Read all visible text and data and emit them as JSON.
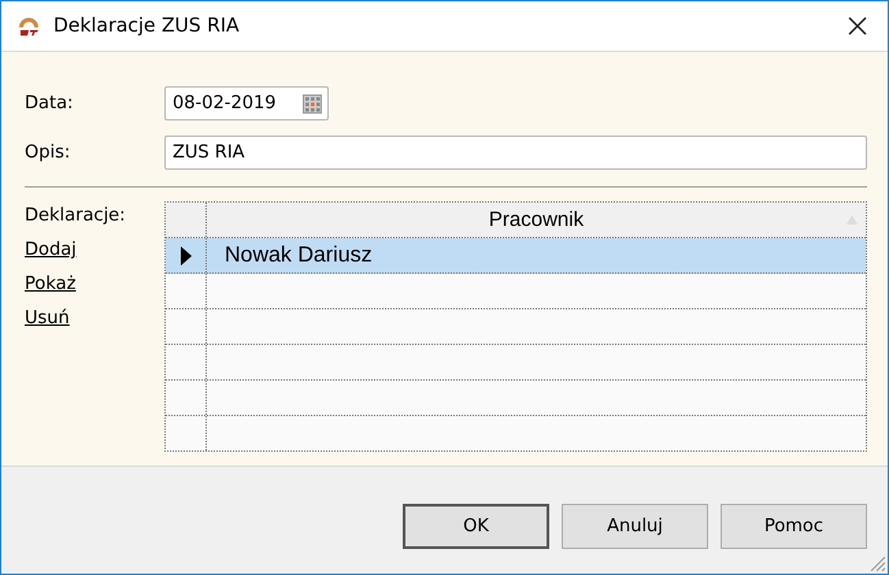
{
  "window": {
    "title": "Deklaracje ZUS RIA"
  },
  "fields": [
    {
      "label": "Data:",
      "value": "08-02-2019",
      "kind": "date"
    },
    {
      "label": "Opis:",
      "value": "ZUS RIA",
      "kind": "text"
    }
  ],
  "declarations": {
    "label": "Deklaracje:",
    "links": [
      "Dodaj",
      "Pokaż",
      "Usuń"
    ]
  },
  "table": {
    "columns": [
      "Pracownik"
    ],
    "rows": [
      {
        "cells": [
          "Nowak Dariusz"
        ],
        "selected": true
      }
    ]
  },
  "buttons": [
    {
      "label": "OK",
      "default": true
    },
    {
      "label": "Anuluj",
      "default": false
    },
    {
      "label": "Pomoc",
      "default": false
    }
  ]
}
